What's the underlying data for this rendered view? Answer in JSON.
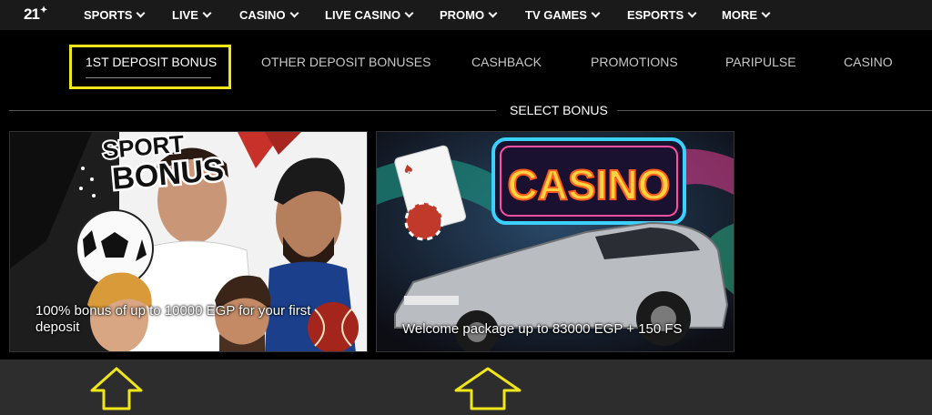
{
  "brand": {
    "logo_text": "21",
    "logo_mark": "✦"
  },
  "nav": {
    "items": [
      {
        "label": "SPORTS"
      },
      {
        "label": "LIVE"
      },
      {
        "label": "CASINO"
      },
      {
        "label": "LIVE CASINO"
      },
      {
        "label": "PROMO"
      },
      {
        "label": "TV GAMES"
      },
      {
        "label": "ESPORTS"
      },
      {
        "label": "MORE"
      }
    ]
  },
  "tabs": {
    "items": [
      {
        "label": "1ST DEPOSIT BONUS",
        "active": true
      },
      {
        "label": "OTHER DEPOSIT BONUSES"
      },
      {
        "label": "CASHBACK"
      },
      {
        "label": "PROMOTIONS"
      },
      {
        "label": "PARIPULSE"
      },
      {
        "label": "CASINO"
      }
    ]
  },
  "section": {
    "title": "SELECT BONUS"
  },
  "cards": [
    {
      "banner_line1": "SPORT",
      "banner_line2": "BONUS",
      "caption_line1": "100% bonus of up to 10000 EGP for your first",
      "caption_line2": "deposit"
    },
    {
      "banner": "CASINO",
      "caption": "Welcome package up to 83000 EGP + 150 FS"
    }
  ],
  "colors": {
    "highlight": "#f0e619",
    "nav_bg": "#1a1a1a",
    "page_bg": "#000000",
    "bottom_bg": "#2d2d2d"
  },
  "icons": {
    "nav_dropdown": "chevron-down-icon",
    "annotation": "up-arrow-icon"
  }
}
